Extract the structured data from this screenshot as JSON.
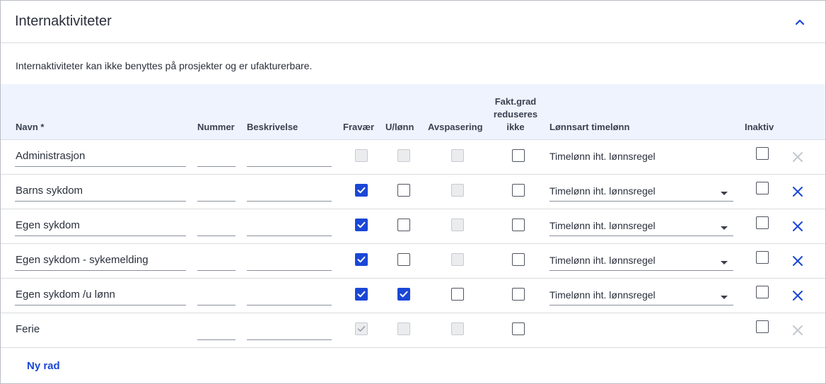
{
  "panel": {
    "title": "Internaktiviteter",
    "collapse_icon": "chevron-up-icon",
    "info_text": "Internaktiviteter kan ikke benyttes på prosjekter og er ufakturerbare."
  },
  "columns": {
    "name": "Navn *",
    "number": "Nummer",
    "description": "Beskrivelse",
    "absence": "Fravær",
    "unpaid": "U/lønn",
    "timeoff": "Avspasering",
    "billing_reduce": [
      "Fakt.grad",
      "reduseres",
      "ikke"
    ],
    "wage_type": "Lønnsart timelønn",
    "inactive": "Inaktiv"
  },
  "rows": [
    {
      "name": "Administrasjon",
      "name_editable": true,
      "number": "",
      "description": "",
      "absence": "disabled",
      "unpaid": "disabled",
      "timeoff": "disabled",
      "billing_reduce": "unchecked",
      "wage_type": "Timelønn iht. lønnsregel",
      "wage_editable": false,
      "inactive": "unchecked",
      "delete": "disabled"
    },
    {
      "name": "Barns sykdom",
      "name_editable": true,
      "number": "",
      "description": "",
      "absence": "checked",
      "unpaid": "unchecked",
      "timeoff": "disabled",
      "billing_reduce": "unchecked",
      "wage_type": "Timelønn iht. lønnsregel",
      "wage_editable": true,
      "inactive": "unchecked",
      "delete": "enabled"
    },
    {
      "name": "Egen sykdom",
      "name_editable": true,
      "number": "",
      "description": "",
      "absence": "checked",
      "unpaid": "unchecked",
      "timeoff": "disabled",
      "billing_reduce": "unchecked",
      "wage_type": "Timelønn iht. lønnsregel",
      "wage_editable": true,
      "inactive": "unchecked",
      "delete": "enabled"
    },
    {
      "name": "Egen sykdom - sykemelding",
      "name_editable": true,
      "number": "",
      "description": "",
      "absence": "checked",
      "unpaid": "unchecked",
      "timeoff": "disabled",
      "billing_reduce": "unchecked",
      "wage_type": "Timelønn iht. lønnsregel",
      "wage_editable": true,
      "inactive": "unchecked",
      "delete": "enabled"
    },
    {
      "name": "Egen sykdom /u lønn",
      "name_editable": true,
      "number": "",
      "description": "",
      "absence": "checked",
      "unpaid": "checked",
      "timeoff": "unchecked",
      "billing_reduce": "unchecked",
      "wage_type": "Timelønn iht. lønnsregel",
      "wage_editable": true,
      "inactive": "unchecked",
      "delete": "enabled"
    },
    {
      "name": "Ferie",
      "name_editable": false,
      "number": "",
      "description": "",
      "absence": "checked-disabled",
      "unpaid": "disabled",
      "timeoff": "disabled",
      "billing_reduce": "unchecked",
      "wage_type": "",
      "wage_editable": false,
      "inactive": "unchecked",
      "delete": "disabled"
    }
  ],
  "new_row_label": "Ny rad",
  "colors": {
    "accent": "#1a47d6",
    "header_bg": "#eff3fd",
    "disabled_icon": "#c5c8ce"
  }
}
